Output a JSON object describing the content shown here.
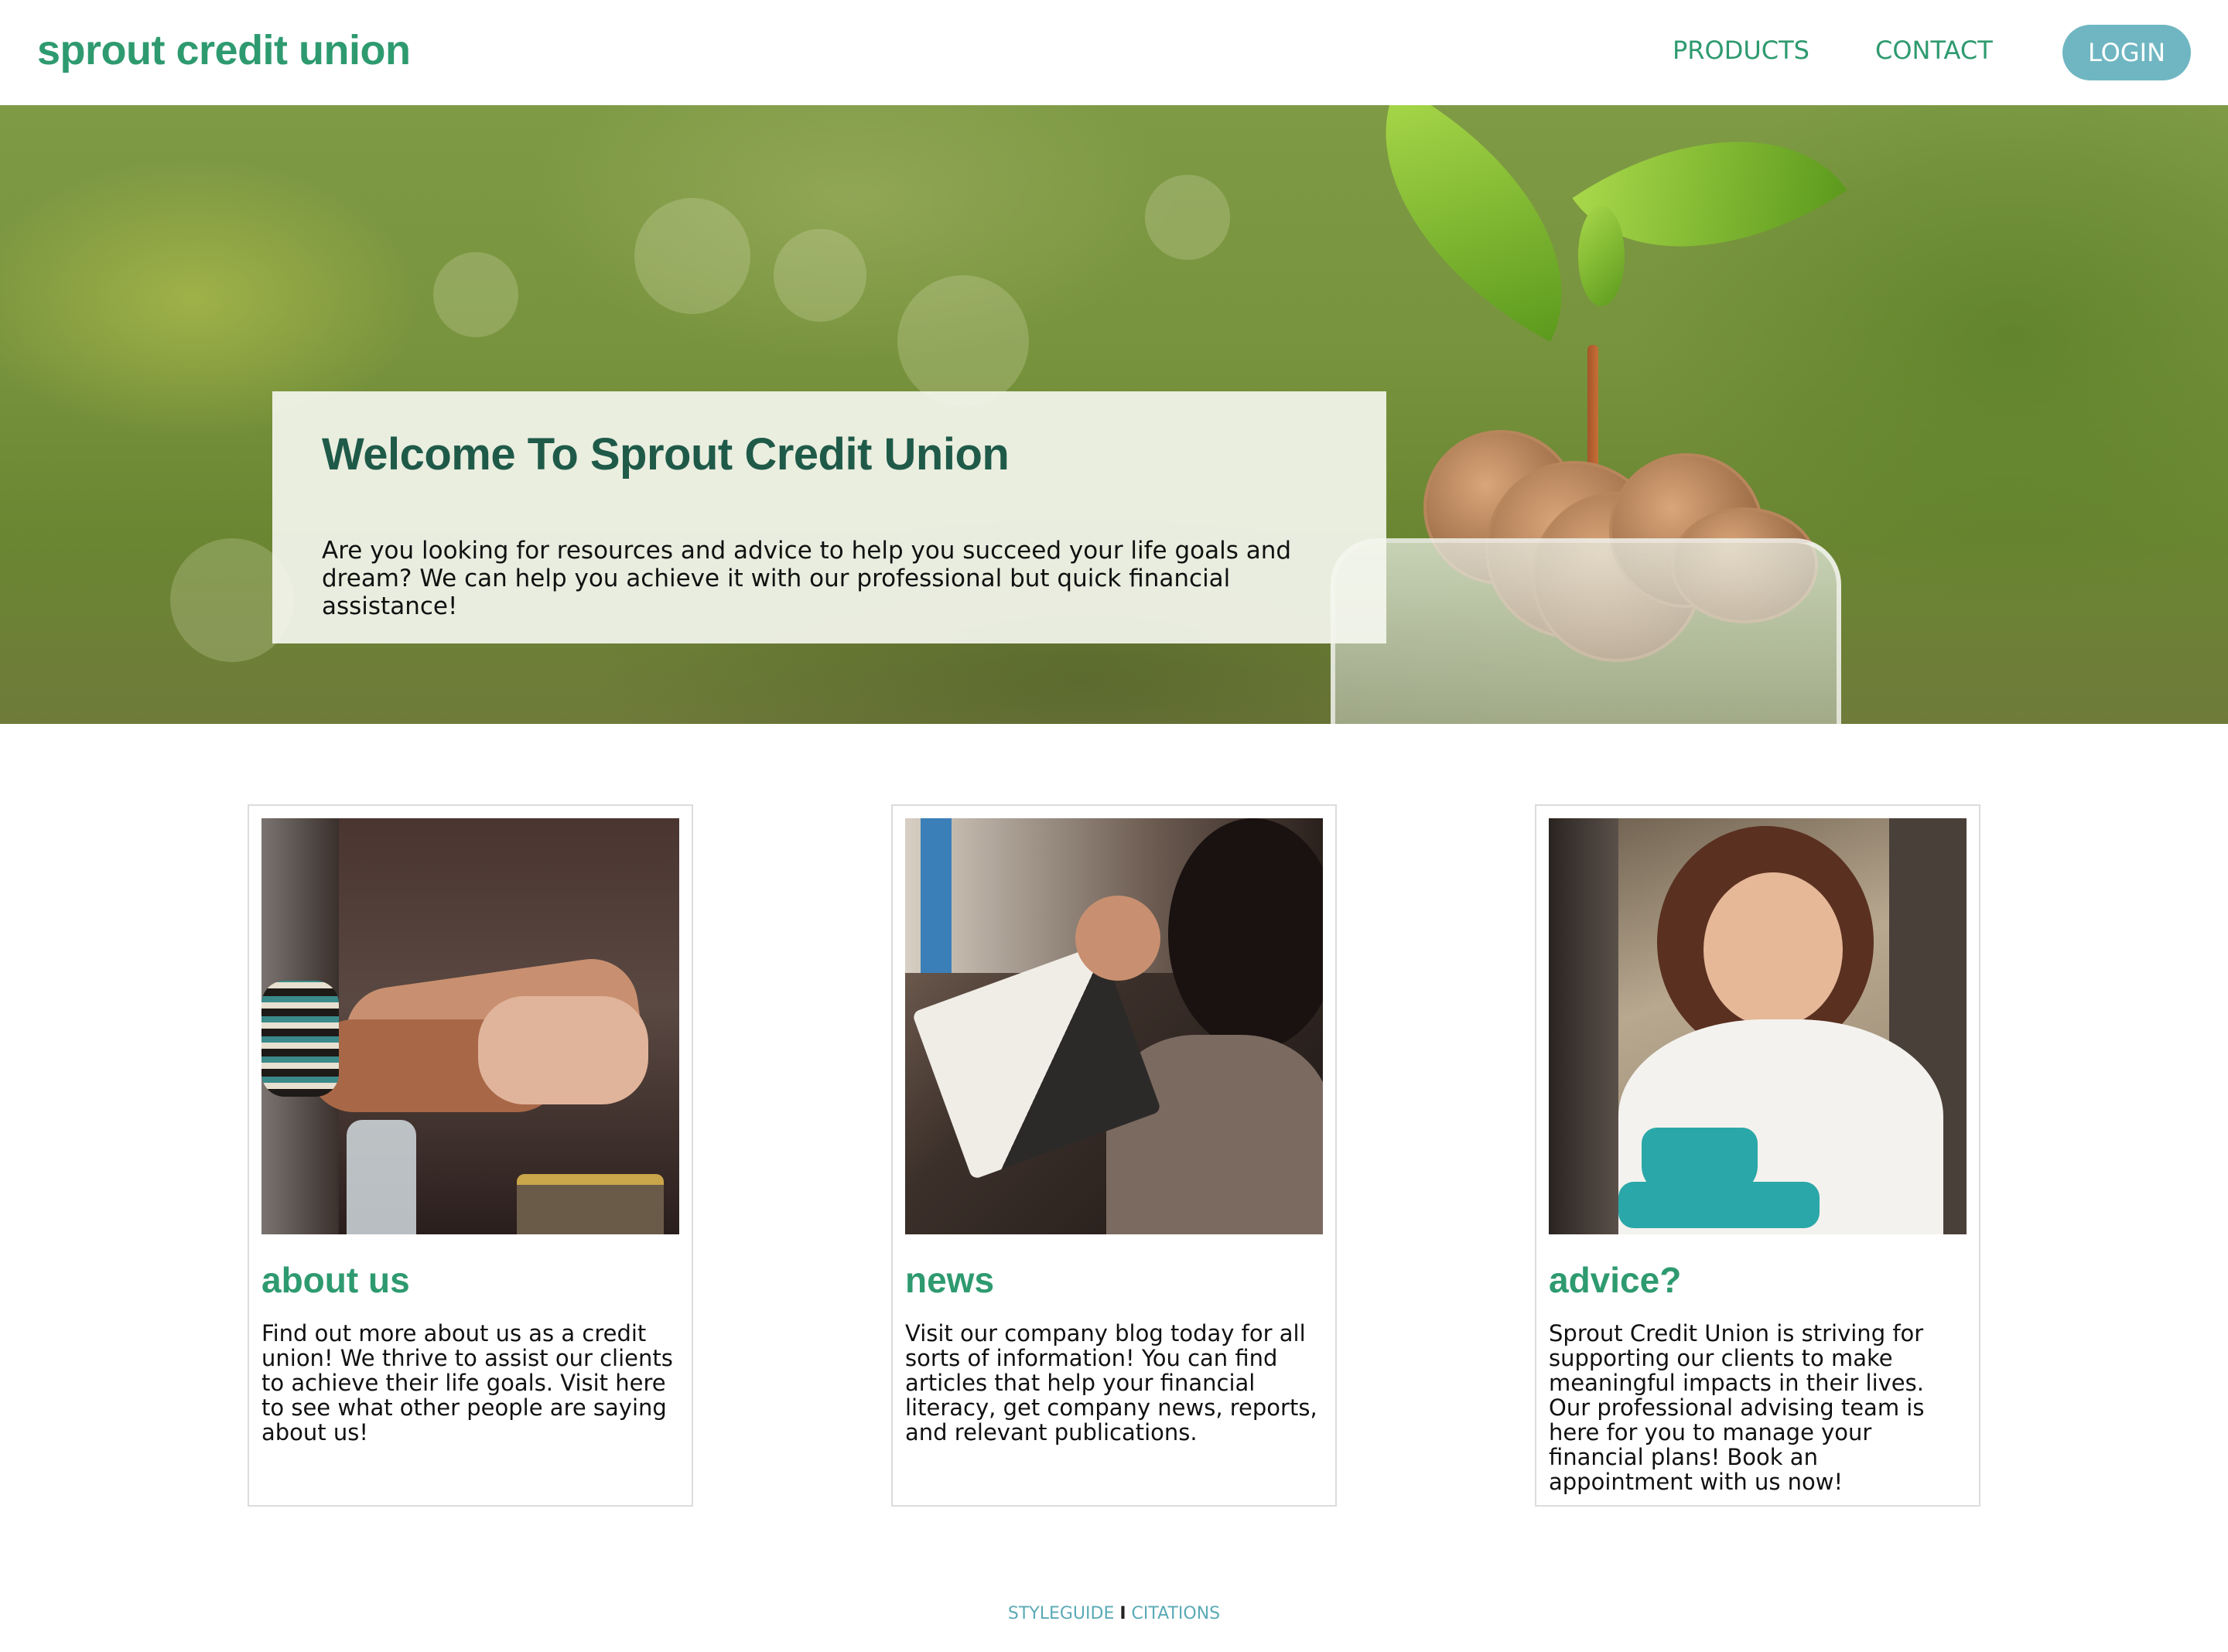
{
  "header": {
    "logo": "sprout credit union",
    "nav": {
      "products": "PRODUCTS",
      "contact": "CONTACT",
      "login": "LOGIN"
    }
  },
  "hero": {
    "title": "Welcome To Sprout Credit Union",
    "text": "Are you looking for resources and advice to help you succeed your life goals and dream? We can help you achieve it with our professional but quick financial assistance!"
  },
  "cards": [
    {
      "title": "about us",
      "text": "Find out more about us as a credit union! We thrive to assist our clients to achieve their life goals. Visit here to see what other people are saying about us!"
    },
    {
      "title": "news",
      "text": "Visit our company blog today for all sorts of information! You can find articles that help your financial literacy, get company news, reports, and relevant publications."
    },
    {
      "title": "advice?",
      "text": "Sprout Credit Union is striving for supporting our clients to make meaningful impacts in their lives. Our professional advising team is here for you to manage your financial plans! Book an appointment with us now!"
    }
  ],
  "footer": {
    "styleguide": "STYLEGUIDE",
    "separator": "I",
    "citations": "CITATIONS"
  },
  "colors": {
    "brand_green": "#2e9a6f",
    "title_dark_green": "#1f5a49",
    "login_teal": "#6fb6c2",
    "footer_link": "#5aaab6"
  }
}
